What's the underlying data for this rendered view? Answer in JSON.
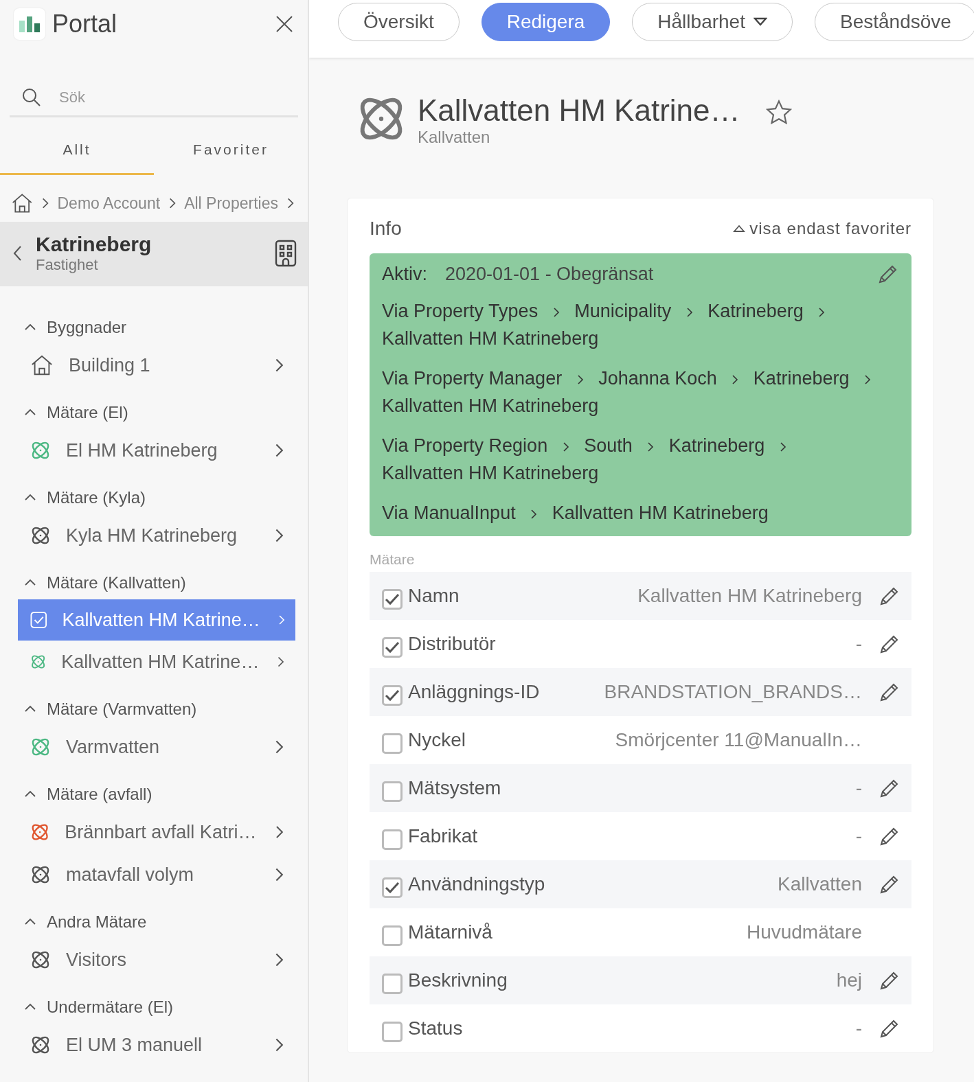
{
  "sidebar": {
    "app_title": "Portal",
    "search": {
      "placeholder": "Sök"
    },
    "tabs": [
      {
        "label": "Allt",
        "selected": true
      },
      {
        "label": "Favoriter",
        "selected": false
      }
    ],
    "breadcrumb": [
      "Demo Account",
      "All Properties"
    ],
    "property": {
      "name": "Katrineberg",
      "type": "Fastighet"
    },
    "sections": [
      {
        "title": "Byggnader",
        "expanded": true,
        "items": [
          {
            "label": "Building 1",
            "kind": "building",
            "selected": false
          }
        ]
      },
      {
        "title": "Mätare (El)",
        "expanded": true,
        "items": [
          {
            "label": "El HM Katrineberg",
            "kind": "meter",
            "color": "#4cb883",
            "selected": false
          }
        ]
      },
      {
        "title": "Mätare (Kyla)",
        "expanded": true,
        "items": [
          {
            "label": "Kyla HM Katrineberg",
            "kind": "meter",
            "color": "#555555",
            "selected": false
          }
        ]
      },
      {
        "title": "Mätare (Kallvatten)",
        "expanded": true,
        "items": [
          {
            "label": "Kallvatten HM Katrine…",
            "selected": true
          },
          {
            "label": "Kallvatten HM Katrine…",
            "kind": "meter",
            "color": "#4cb883",
            "selected": false
          }
        ]
      },
      {
        "title": "Mätare (Varmvatten)",
        "expanded": true,
        "items": [
          {
            "label": "Varmvatten",
            "kind": "meter",
            "color": "#4cb883",
            "selected": false
          }
        ]
      },
      {
        "title": "Mätare (avfall)",
        "expanded": true,
        "items": [
          {
            "label": "Brännbart avfall Katri…",
            "kind": "meter",
            "color": "#e0562f",
            "selected": false
          },
          {
            "label": "matavfall volym",
            "kind": "meter",
            "color": "#555555",
            "selected": false
          }
        ]
      },
      {
        "title": "Andra Mätare",
        "expanded": true,
        "items": [
          {
            "label": "Visitors",
            "kind": "meter",
            "color": "#555555",
            "selected": false
          }
        ]
      },
      {
        "title": "Undermätare (El)",
        "expanded": true,
        "items": [
          {
            "label": "El UM 3 manuell",
            "kind": "meter",
            "color": "#555555",
            "selected": false
          }
        ]
      }
    ]
  },
  "nav_tabs": [
    {
      "label": "Översikt",
      "kind": "tab",
      "selected": false
    },
    {
      "label": "Redigera",
      "kind": "tab",
      "selected": true
    },
    {
      "label": "Hållbarhet",
      "kind": "dropdown",
      "selected": false
    },
    {
      "label": "Beståndsöve",
      "kind": "tab",
      "selected": false
    }
  ],
  "header": {
    "title": "Kallvatten HM Katrine…",
    "subtitle": "Kallvatten",
    "favorite": false
  },
  "info": {
    "title": "Info",
    "favorites_toggle": "visa endast favoriter",
    "active": {
      "label": "Aktiv:",
      "value": "2020-01-01 - Obegränsat"
    },
    "paths": [
      [
        "Via Property Types",
        "Municipality",
        "Katrineberg",
        "Kallvatten HM Katrineberg"
      ],
      [
        "Via Property Manager",
        "Johanna Koch",
        "Katrineberg",
        "Kallvatten HM Katrineberg"
      ],
      [
        "Via Property Region",
        "South",
        "Katrineberg",
        "Kallvatten HM Katrineberg"
      ],
      [
        "Via ManualInput",
        "Kallvatten HM Katrineberg"
      ]
    ],
    "group_label": "Mätare",
    "fields": [
      {
        "label": "Namn",
        "value": "Kallvatten HM Katrineberg",
        "checked": true,
        "editable": true
      },
      {
        "label": "Distributör",
        "value": "-",
        "checked": true,
        "editable": true
      },
      {
        "label": "Anläggnings-ID",
        "value": "BRANDSTATION_BRANDS…",
        "checked": true,
        "editable": true
      },
      {
        "label": "Nyckel",
        "value": "Smörjcenter 11@ManualIn…",
        "checked": false,
        "editable": false
      },
      {
        "label": "Mätsystem",
        "value": "-",
        "checked": false,
        "editable": true
      },
      {
        "label": "Fabrikat",
        "value": "-",
        "checked": false,
        "editable": true
      },
      {
        "label": "Användningstyp",
        "value": "Kallvatten",
        "checked": true,
        "editable": true
      },
      {
        "label": "Mätarnivå",
        "value": "Huvudmätare",
        "checked": false,
        "editable": false
      },
      {
        "label": "Beskrivning",
        "value": "hej",
        "checked": false,
        "editable": true
      },
      {
        "label": "Status",
        "value": "-",
        "checked": false,
        "editable": true
      }
    ]
  }
}
